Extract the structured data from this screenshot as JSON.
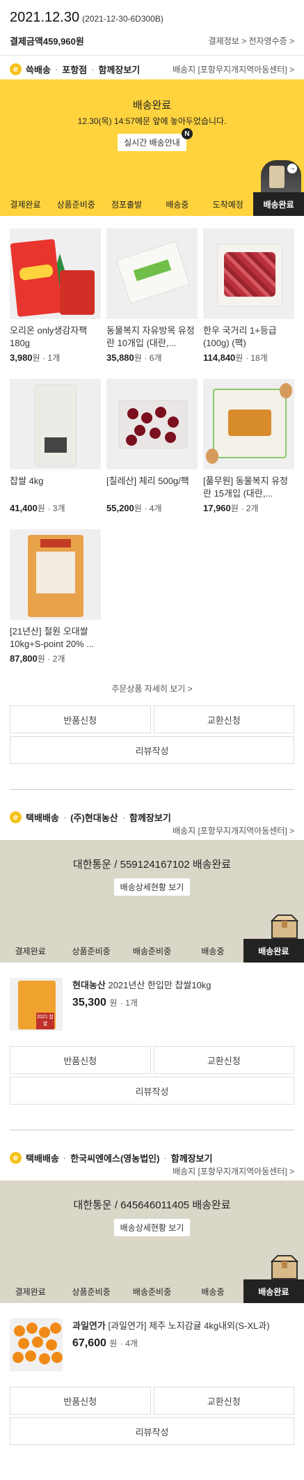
{
  "header": {
    "date": "2021.12.30",
    "order_no": "(2021-12-30-6D300B)",
    "pay_label": "결제금액",
    "pay_amount": "459,960원",
    "links": "결제정보 > 전자영수증 >"
  },
  "sections": [
    {
      "badge": "e",
      "title_parts": [
        "쓱배송",
        "포항점",
        "함께장보기"
      ],
      "right_text": "배송지 [포항무지개지역아동센터] >",
      "banner": {
        "title": "배송완료",
        "subtitle": "12.30(목) 14:57에문 앞에 놓아두었습니다.",
        "button": "실시간 배송안내",
        "n_mark": "N"
      },
      "steps": [
        "결제완료",
        "상품준비중",
        "점포출발",
        "배송중",
        "도착예정",
        "배송완료"
      ],
      "products": [
        {
          "name": "오리온 only생감자팩 180g",
          "price": "3,980",
          "unit": "원",
          "qty": "· 1개"
        },
        {
          "name": "동물복지 자유방목 유정란 10개입 (대란,...",
          "price": "35,880",
          "unit": "원",
          "qty": "· 6개"
        },
        {
          "name": "한우 국거리 1+등급 (100g) (팩)",
          "price": "114,840",
          "unit": "원",
          "qty": "· 18개"
        },
        {
          "name": "찹쌀 4kg",
          "price": "41,400",
          "unit": "원",
          "qty": "· 3개"
        },
        {
          "name": "[칠레산] 체리 500g/팩",
          "price": "55,200",
          "unit": "원",
          "qty": "· 4개"
        },
        {
          "name": "[풀무원] 동물복지 유정란 15개입 (대란,...",
          "price": "17,960",
          "unit": "원",
          "qty": "· 2개"
        },
        {
          "name": "[21년산] 철원 오대쌀 10kg+S-point 20% ...",
          "price": "87,800",
          "unit": "원",
          "qty": "· 2개"
        }
      ],
      "detail_link": "주문상품 자세히 보기 >",
      "buttons": {
        "return": "반품신청",
        "exchange": "교환신청",
        "review": "리뷰작성"
      }
    },
    {
      "badge": "e",
      "title_parts": [
        "택배배송",
        "(주)현대농산",
        "함께장보기"
      ],
      "sub_text": "배송지 [포항무지개지역아동센터] >",
      "banner": {
        "title": "대한통운 / 559124167102 배송완료",
        "button": "배송상세현황 보기"
      },
      "steps": [
        "결제완료",
        "상품준비중",
        "배송준비중",
        "배송중",
        "배송완료"
      ],
      "product": {
        "seller": "현대농산",
        "name": "2021년산 한입만 찹쌀10kg",
        "price": "35,300",
        "unit": "원",
        "qty": "· 1개",
        "tag": "2021 찹쌀"
      },
      "buttons": {
        "return": "반품신청",
        "exchange": "교환신청",
        "review": "리뷰작성"
      }
    },
    {
      "badge": "e",
      "title_parts": [
        "택배배송",
        "한국씨엔에스(영농법인)",
        "함께장보기"
      ],
      "sub_text": "배송지 [포항무지개지역아동센터] >",
      "banner": {
        "title": "대한통운 / 645646011405 배송완료",
        "button": "배송상세현황 보기"
      },
      "steps": [
        "결제완료",
        "상품준비중",
        "배송준비중",
        "배송중",
        "배송완료"
      ],
      "product": {
        "seller": "과일연가",
        "name": "[과일연가] 제주 노지감귤 4kg내외(S-XL과)",
        "price": "67,600",
        "unit": "원",
        "qty": "· 4개"
      },
      "buttons": {
        "return": "반품신청",
        "exchange": "교환신청",
        "review": "리뷰작성"
      }
    }
  ]
}
